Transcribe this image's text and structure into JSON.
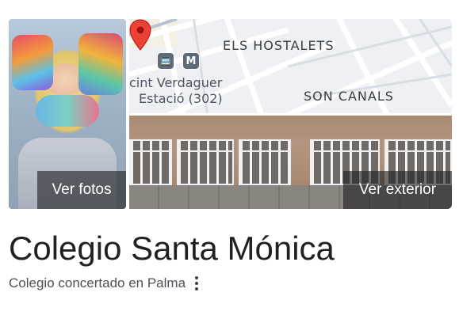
{
  "gallery": {
    "photos_label": "Ver fotos",
    "exterior_label": "Ver exterior"
  },
  "map": {
    "area_label_1": "ELS HOSTALETS",
    "area_label_2": "SON CANALS",
    "station_line_1": "cint Verdaguer",
    "station_line_2": "Estació (302)",
    "bus_badge": "🚍",
    "metro_badge": "M"
  },
  "place": {
    "name": "Colegio Santa Mónica",
    "category": "Colegio concertado en Palma"
  },
  "colors": {
    "pin": "#ea4335",
    "transit_badge": "#5f6a78",
    "title": "#202124",
    "subtitle": "#4d5156"
  },
  "icons": {
    "pin": "map-pin-icon",
    "bus": "bus-icon",
    "metro": "metro-icon",
    "more": "more-vert-icon"
  }
}
